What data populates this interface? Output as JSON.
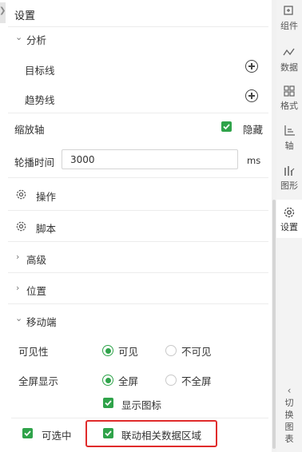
{
  "panel": {
    "title": "设置",
    "analysis": {
      "label": "分析",
      "items": [
        {
          "label": "目标线"
        },
        {
          "label": "趋势线"
        }
      ]
    },
    "zoom_axis": {
      "label": "缩放轴",
      "checkbox_label": "隐藏",
      "checked": true
    },
    "carousel": {
      "label": "轮播时间",
      "value": "3000",
      "unit": "ms"
    },
    "action": {
      "label": "操作"
    },
    "script": {
      "label": "脚本"
    },
    "advanced": {
      "label": "高级"
    },
    "position": {
      "label": "位置"
    },
    "mobile": {
      "label": "移动端",
      "visibility": {
        "label": "可见性",
        "options": [
          "可见",
          "不可见"
        ],
        "selected": "可见"
      },
      "fullscreen": {
        "label": "全屏显示",
        "options": [
          "全屏",
          "不全屏"
        ],
        "selected": "全屏"
      },
      "show_icon": {
        "label": "显示图标",
        "checked": true
      }
    },
    "selectable": {
      "label": "可选中",
      "checked": true
    },
    "linked_area": {
      "label": "联动相关数据区域",
      "checked": true
    }
  },
  "rail": {
    "items": [
      {
        "label": "组件",
        "icon": "component-icon"
      },
      {
        "label": "数据",
        "icon": "data-icon"
      },
      {
        "label": "格式",
        "icon": "format-icon"
      },
      {
        "label": "轴",
        "icon": "axis-icon"
      },
      {
        "label": "图形",
        "icon": "graphic-icon"
      },
      {
        "label": "设置",
        "icon": "settings-icon",
        "active": true
      }
    ],
    "switch_label": "切换图表"
  },
  "colors": {
    "accent_green": "#2fa34a",
    "highlight_red": "#e02b2b"
  }
}
